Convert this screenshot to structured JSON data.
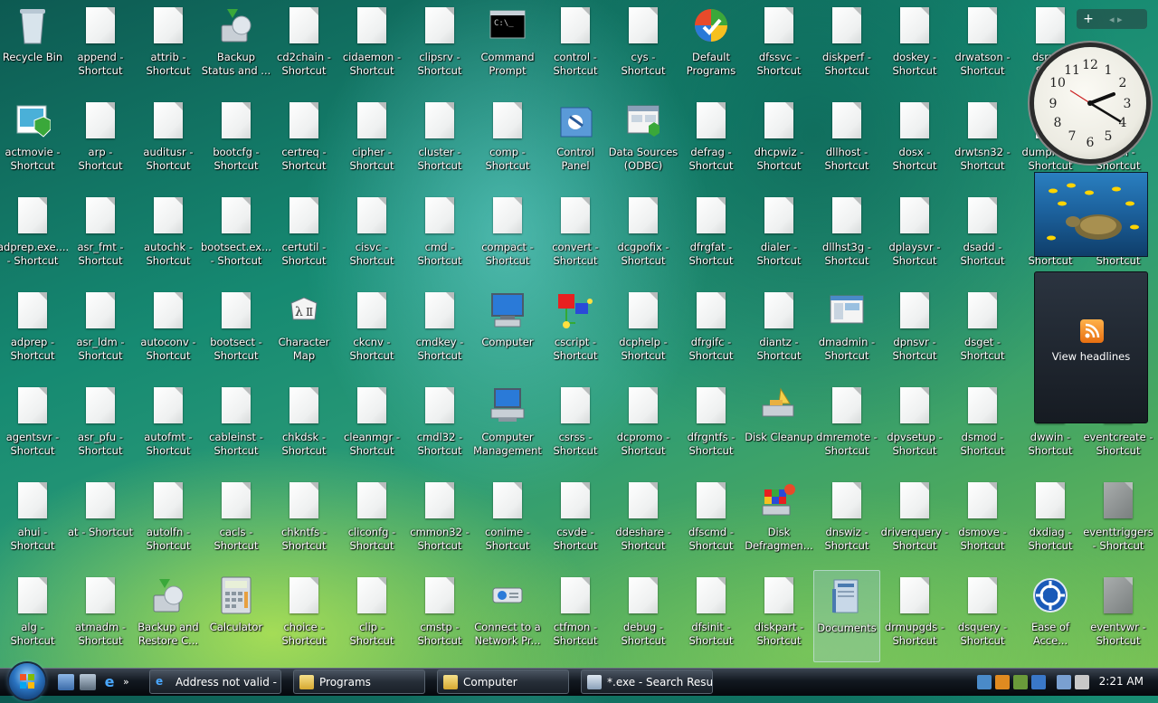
{
  "desktop": {
    "icons": [
      [
        "Recycle Bin",
        "append -\nShortcut",
        "attrib -\nShortcut",
        "Backup\nStatus and ...",
        "cd2chain -\nShortcut",
        "cidaemon -\nShortcut",
        "clipsrv -\nShortcut",
        "Command\nPrompt",
        "control -\nShortcut",
        "cys -\nShortcut",
        "Default\nPrograms",
        "dfssvc -\nShortcut",
        "diskperf -\nShortcut",
        "doskey -\nShortcut",
        "drwatson -\nShortcut",
        "dsrm...\nSho..."
      ],
      [
        "actmovie -\nShortcut",
        "arp -\nShortcut",
        "auditusr -\nShortcut",
        "bootcfg -\nShortcut",
        "certreq -\nShortcut",
        "cipher -\nShortcut",
        "cluster -\nShortcut",
        "comp -\nShortcut",
        "Control\nPanel",
        "Data Sources\n(ODBC)",
        "defrag -\nShortcut",
        "dhcpwiz -\nShortcut",
        "dllhost -\nShortcut",
        "dosx -\nShortcut",
        "drwtsn32 -\nShortcut",
        "dumprep...\nShortcut",
        "...ctrl -\nShortcut"
      ],
      [
        "adprep.exe....\n- Shortcut",
        "asr_fmt -\nShortcut",
        "autochk -\nShortcut",
        "bootsect.ex...\n- Shortcut",
        "certutil -\nShortcut",
        "cisvc -\nShortcut",
        "cmd -\nShortcut",
        "compact -\nShortcut",
        "convert -\nShortcut",
        "dcgpofix -\nShortcut",
        "dfrgfat -\nShortcut",
        "dialer -\nShortcut",
        "dllhst3g -\nShortcut",
        "dplaysvr -\nShortcut",
        "dsadd -\nShortcut",
        "...\nShortcut",
        "...\nShortcut"
      ],
      [
        "adprep -\nShortcut",
        "asr_ldm -\nShortcut",
        "autoconv -\nShortcut",
        "bootsect -\nShortcut",
        "Character\nMap",
        "ckcnv -\nShortcut",
        "cmdkey -\nShortcut",
        "Computer",
        "cscript -\nShortcut",
        "dcphelp -\nShortcut",
        "dfrgifc -\nShortcut",
        "diantz -\nShortcut",
        "dmadmin -\nShortcut",
        "dpnsvr -\nShortcut",
        "dsget -\nShortcut",
        "dv...\nSh..."
      ],
      [
        "agentsvr -\nShortcut",
        "asr_pfu -\nShortcut",
        "autofmt -\nShortcut",
        "cableinst -\nShortcut",
        "chkdsk -\nShortcut",
        "cleanmgr -\nShortcut",
        "cmdl32 -\nShortcut",
        "Computer\nManagement",
        "csrss -\nShortcut",
        "dcpromo -\nShortcut",
        "dfrgntfs -\nShortcut",
        "Disk Cleanup",
        "dmremote -\nShortcut",
        "dpvsetup -\nShortcut",
        "dsmod -\nShortcut",
        "dwwin -\nShortcut",
        "eventcreate -\nShortcut"
      ],
      [
        "ahui -\nShortcut",
        "at - Shortcut",
        "autolfn -\nShortcut",
        "cacls -\nShortcut",
        "chkntfs -\nShortcut",
        "cliconfg -\nShortcut",
        "cmmon32 -\nShortcut",
        "conime -\nShortcut",
        "csvde -\nShortcut",
        "ddeshare -\nShortcut",
        "dfscmd -\nShortcut",
        "Disk\nDefragmen...",
        "dnswiz -\nShortcut",
        "driverquery -\nShortcut",
        "dsmove -\nShortcut",
        "dxdiag -\nShortcut",
        "eventtriggers\n- Shortcut"
      ],
      [
        "alg -\nShortcut",
        "atmadm -\nShortcut",
        "Backup and\nRestore C...",
        "Calculator",
        "choice -\nShortcut",
        "clip -\nShortcut",
        "cmstp -\nShortcut",
        "Connect to a\nNetwork Pr...",
        "ctfmon -\nShortcut",
        "debug -\nShortcut",
        "dfsinit -\nShortcut",
        "diskpart -\nShortcut",
        "Documents",
        "drmupgds -\nShortcut",
        "dsquery -\nShortcut",
        "Ease of\nAcce...",
        "eventvwr -\nShortcut"
      ]
    ]
  },
  "gadgets": {
    "add": "+",
    "arrows": "◂ ▸",
    "feed_label": "View headlines"
  },
  "taskbar": {
    "tasks": [
      "Address not valid - ...",
      "Programs",
      "Computer",
      "*.exe - Search Resul..."
    ],
    "time": "2:21 AM"
  },
  "colors": {
    "accent": "#2a73c0"
  }
}
